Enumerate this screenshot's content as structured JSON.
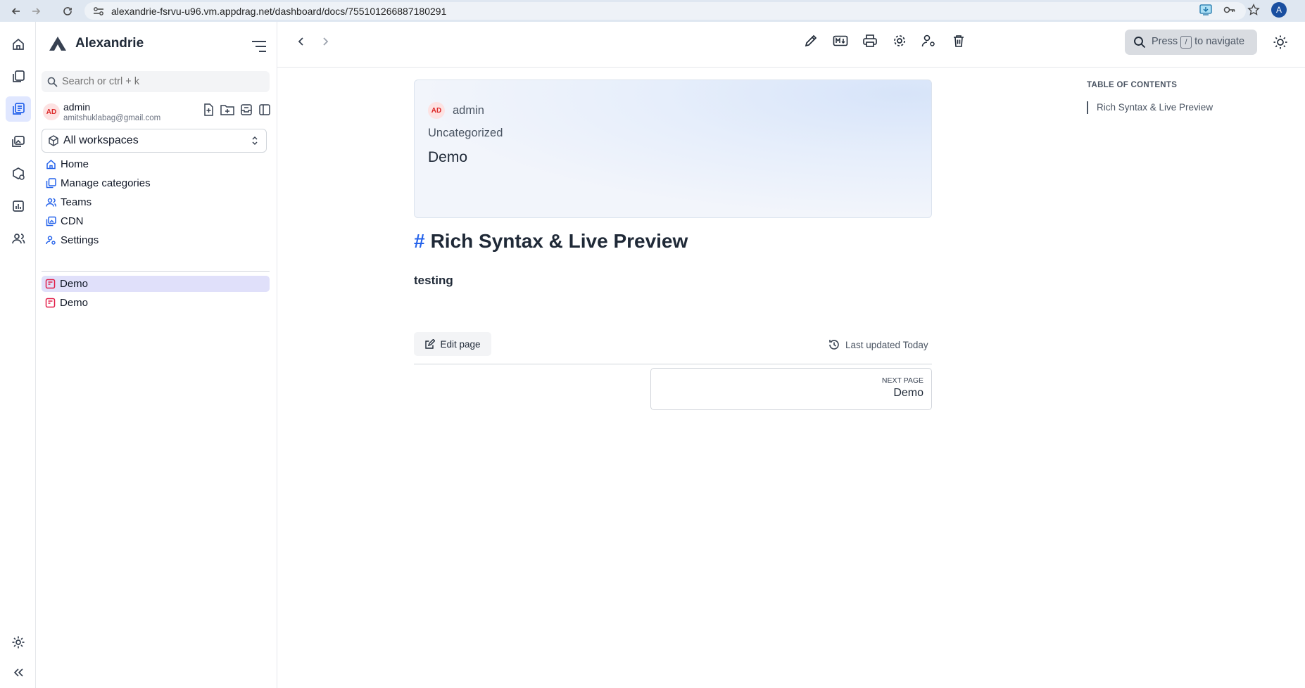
{
  "browser": {
    "url": "alexandrie-fsrvu-u96.vm.appdrag.net/dashboard/docs/755101266887180291",
    "profile_initial": "A"
  },
  "app": {
    "name": "Alexandrie",
    "accent": "#2563eb"
  },
  "sidebar": {
    "search_placeholder": "Search or ctrl + k",
    "user": {
      "initials": "AD",
      "name": "admin",
      "email": "amitshuklabag@gmail.com"
    },
    "workspace": "All workspaces",
    "menu": [
      {
        "label": "Home",
        "icon": "home-icon"
      },
      {
        "label": "Manage categories",
        "icon": "library-icon"
      },
      {
        "label": "Teams",
        "icon": "users-icon"
      },
      {
        "label": "CDN",
        "icon": "images-icon"
      },
      {
        "label": "Settings",
        "icon": "user-cog-icon"
      }
    ],
    "documents": [
      {
        "label": "Demo",
        "active": true
      },
      {
        "label": "Demo",
        "active": false
      }
    ]
  },
  "toolbar": {
    "search_prefix": "Press",
    "search_key": "/",
    "search_suffix": "to navigate"
  },
  "document": {
    "author_initials": "AD",
    "author": "admin",
    "category": "Uncategorized",
    "title": "Demo",
    "heading_hash": "#",
    "heading": "Rich Syntax & Live Preview",
    "body": "testing",
    "edit_label": "Edit page",
    "last_updated": "Last updated Today",
    "next_label": "NEXT PAGE",
    "next_title": "Demo"
  },
  "toc": {
    "title": "TABLE OF CONTENTS",
    "items": [
      "Rich Syntax & Live Preview"
    ]
  }
}
